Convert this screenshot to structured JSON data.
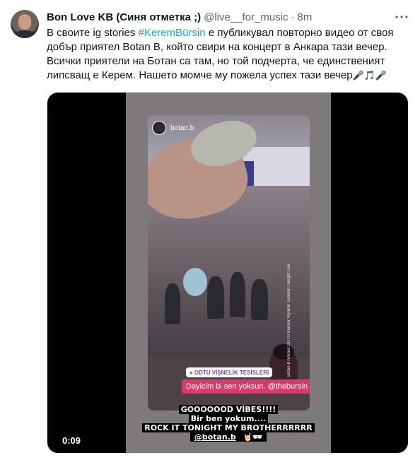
{
  "tweet": {
    "display_name": "Bon Love KB (Синя отметка ;)",
    "handle": "@live__for_music",
    "separator": "·",
    "time": "8m",
    "more_icon": "more-dots-icon",
    "text": {
      "part1": "В своите ig stories ",
      "hashtag": "#KeremBürsin",
      "part2": " е публикувал повторно видео от своя добър приятел Botan B, който свири на концерт в Анкара тази вечер. Всички приятели на Ботан са там, но той подчерта, че единственият липсващ е Керем. Нашето момче му пожела успех тази вечер",
      "emojis": "🎤🎵🎤"
    }
  },
  "media": {
    "story": {
      "username": "botan.b",
      "location_sticker": "ODTÜ VİŞNELİK TESİSLERİ",
      "pink_sticker": "Dayicim bi sen yoksun. @thebursin",
      "caption_lines": [
        "GOOOOOOD VİBES!!!!",
        "Bir ben yokum....",
        "ROCK IT TONIGHT MY BROTHERRRRRR"
      ],
      "caption_mention": "@botan.b",
      "caption_emojis": "🤘🏻🕶",
      "vertical_text": "Botan-b Ankara ODTÜ Konser Vişnelik Tesisleri Tonight Live"
    },
    "timestamp": "0:09"
  },
  "colors": {
    "link": "#1d9bf0",
    "secondary_text": "#536471",
    "story_sticker_pink": "#d63b6c",
    "location_purple": "#7b3fd1"
  }
}
